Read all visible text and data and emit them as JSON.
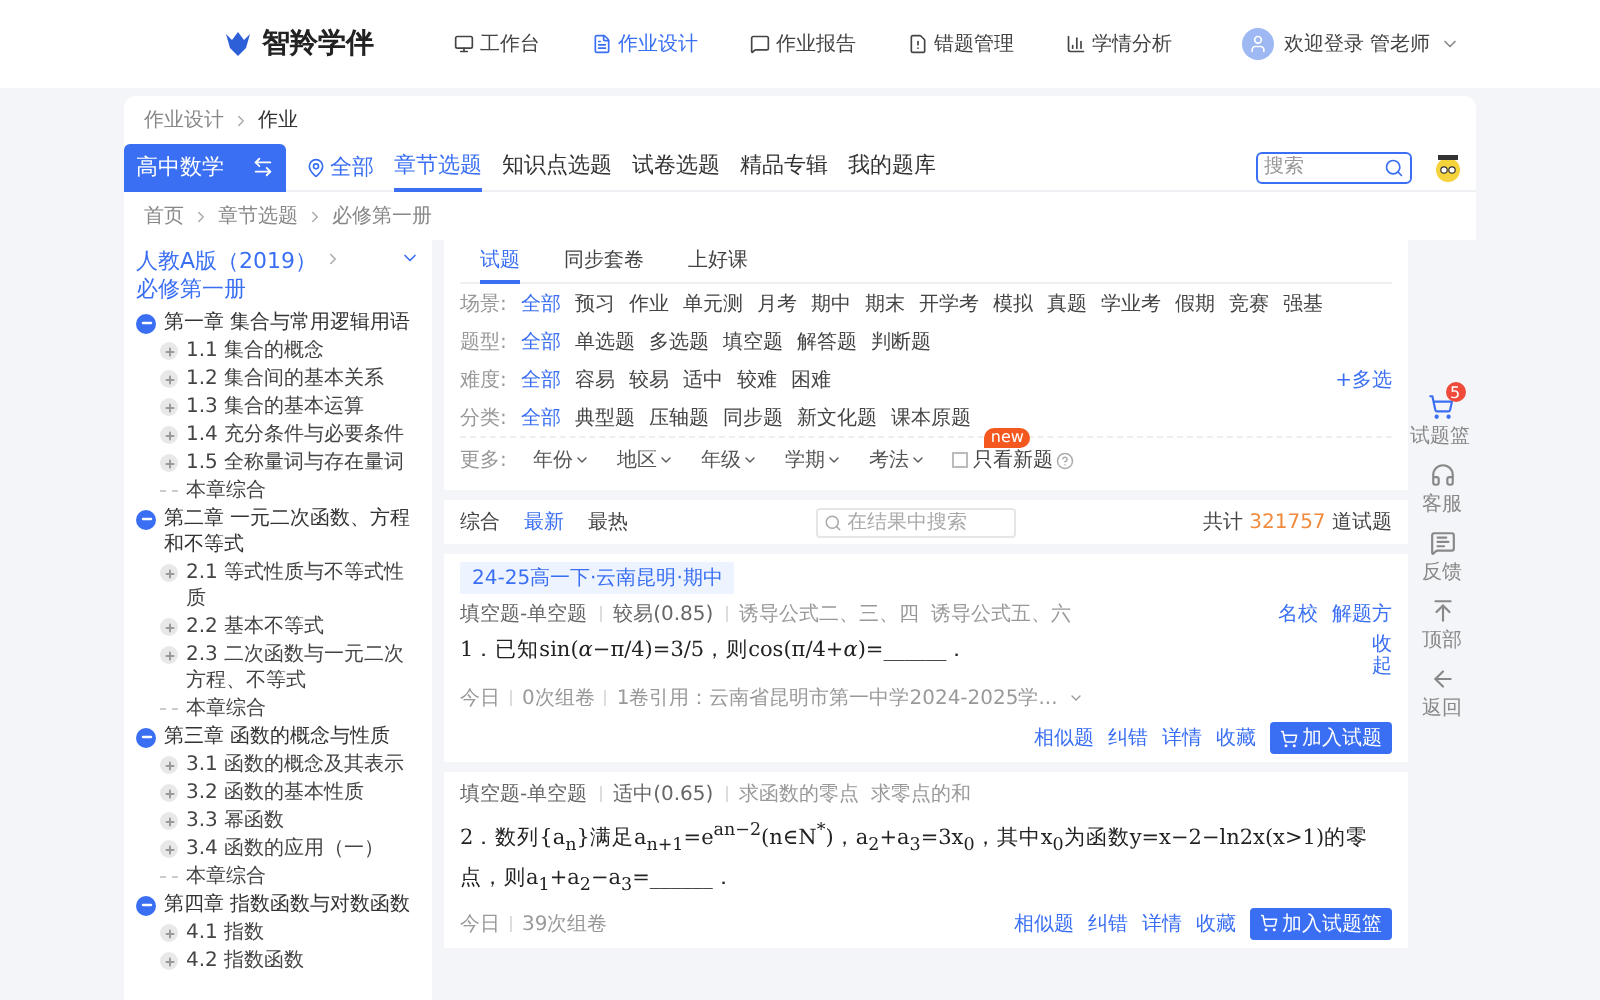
{
  "header": {
    "brand": "智羚学伴",
    "nav": [
      {
        "label": "工作台",
        "selected": false
      },
      {
        "label": "作业设计",
        "selected": true
      },
      {
        "label": "作业报告",
        "selected": false
      },
      {
        "label": "错题管理",
        "selected": false
      },
      {
        "label": "学情分析",
        "selected": false
      }
    ],
    "user": "欢迎登录 管老师"
  },
  "breadcrumb": [
    "作业设计",
    "作业"
  ],
  "subject": "高中数学",
  "location": "全部",
  "tabs": [
    {
      "label": "章节选题",
      "selected": true
    },
    {
      "label": "知识点选题",
      "selected": false
    },
    {
      "label": "试卷选题",
      "selected": false
    },
    {
      "label": "精品专辑",
      "selected": false
    },
    {
      "label": "我的题库",
      "selected": false
    }
  ],
  "search": {
    "placeholder": "搜索"
  },
  "sub_breadcrumb": [
    "首页",
    "章节选题",
    "必修第一册"
  ],
  "sidebar": {
    "edition": "人教A版（2019）",
    "volume": "必修第一册",
    "chapters": [
      {
        "label": "第一章 集合与常用逻辑用语",
        "expanded": true,
        "children": [
          {
            "label": "1.1 集合的概念",
            "kind": "node"
          },
          {
            "label": "1.2 集合间的基本关系",
            "kind": "node"
          },
          {
            "label": "1.3 集合的基本运算",
            "kind": "node"
          },
          {
            "label": "1.4 充分条件与必要条件",
            "kind": "node"
          },
          {
            "label": "1.5 全称量词与存在量词",
            "kind": "node"
          },
          {
            "label": "本章综合",
            "kind": "leaf"
          }
        ]
      },
      {
        "label": "第二章 一元二次函数、方程和不等式",
        "expanded": true,
        "children": [
          {
            "label": "2.1 等式性质与不等式性质",
            "kind": "node"
          },
          {
            "label": "2.2 基本不等式",
            "kind": "node"
          },
          {
            "label": "2.3 二次函数与一元二次方程、不等式",
            "kind": "node"
          },
          {
            "label": "本章综合",
            "kind": "leaf"
          }
        ]
      },
      {
        "label": "第三章 函数的概念与性质",
        "expanded": true,
        "children": [
          {
            "label": "3.1 函数的概念及其表示",
            "kind": "node"
          },
          {
            "label": "3.2 函数的基本性质",
            "kind": "node"
          },
          {
            "label": "3.3 幂函数",
            "kind": "node"
          },
          {
            "label": "3.4 函数的应用（一）",
            "kind": "node"
          },
          {
            "label": "本章综合",
            "kind": "leaf"
          }
        ]
      },
      {
        "label": "第四章 指数函数与对数函数",
        "expanded": true,
        "children": [
          {
            "label": "4.1 指数",
            "kind": "node"
          },
          {
            "label": "4.2 指数函数",
            "kind": "node"
          }
        ]
      }
    ]
  },
  "content_tabs": [
    {
      "label": "试题",
      "selected": true
    },
    {
      "label": "同步套卷",
      "selected": false
    },
    {
      "label": "上好课",
      "selected": false
    }
  ],
  "filters": [
    {
      "label": "场景:",
      "options": [
        {
          "label": "全部",
          "selected": true
        },
        {
          "label": "预习",
          "selected": false
        },
        {
          "label": "作业",
          "selected": false
        },
        {
          "label": "单元测",
          "selected": false
        },
        {
          "label": "月考",
          "selected": false
        },
        {
          "label": "期中",
          "selected": false
        },
        {
          "label": "期末",
          "selected": false
        },
        {
          "label": "开学考",
          "selected": false
        },
        {
          "label": "模拟",
          "selected": false
        },
        {
          "label": "真题",
          "selected": false
        },
        {
          "label": "学业考",
          "selected": false
        },
        {
          "label": "假期",
          "selected": false
        },
        {
          "label": "竞赛",
          "selected": false
        },
        {
          "label": "强基",
          "selected": false
        }
      ]
    },
    {
      "label": "题型:",
      "options": [
        {
          "label": "全部",
          "selected": true
        },
        {
          "label": "单选题",
          "selected": false
        },
        {
          "label": "多选题",
          "selected": false
        },
        {
          "label": "填空题",
          "selected": false
        },
        {
          "label": "解答题",
          "selected": false
        },
        {
          "label": "判断题",
          "selected": false
        }
      ]
    },
    {
      "label": "难度:",
      "extra": "+多选",
      "options": [
        {
          "label": "全部",
          "selected": true
        },
        {
          "label": "容易",
          "selected": false
        },
        {
          "label": "较易",
          "selected": false
        },
        {
          "label": "适中",
          "selected": false
        },
        {
          "label": "较难",
          "selected": false
        },
        {
          "label": "困难",
          "selected": false
        }
      ]
    },
    {
      "label": "分类:",
      "options": [
        {
          "label": "全部",
          "selected": true
        },
        {
          "label": "典型题",
          "selected": false
        },
        {
          "label": "压轴题",
          "selected": false
        },
        {
          "label": "同步题",
          "selected": false
        },
        {
          "label": "新文化题",
          "selected": false
        },
        {
          "label": "课本原题",
          "selected": false
        }
      ]
    }
  ],
  "more": {
    "label": "更多:",
    "dropdowns": [
      "年份",
      "地区",
      "年级",
      "学期",
      "考法"
    ],
    "new_only": {
      "label": "只看新题",
      "checked": false,
      "badge": "new"
    }
  },
  "sort": {
    "options": [
      {
        "label": "综合",
        "selected": false
      },
      {
        "label": "最新",
        "selected": true
      },
      {
        "label": "最热",
        "selected": false
      }
    ],
    "placeholder": "在结果中搜索",
    "total_prefix": "共计",
    "total": "321757",
    "total_suffix": "道试题"
  },
  "questions": [
    {
      "source": "24-25高一下·云南昆明·期中",
      "type": "填空题-单空题",
      "difficulty": "较易(0.85)",
      "knowledge": [
        "诱导公式二、三、四",
        "诱导公式五、六"
      ],
      "links": [
        "名校",
        "解题方"
      ],
      "stem": "1．已知sin(*α*−π/4)=3/5，则cos(π/4+*α*)=______．",
      "collapse": "收起",
      "date": "今日",
      "uses": "0次组卷",
      "cited": "1卷引用：云南省昆明市第一中学2024-2025学...",
      "actions": [
        "相似题",
        "纠错",
        "详情",
        "收藏"
      ],
      "add": "加入试题"
    },
    {
      "type": "填空题-单空题",
      "difficulty": "适中(0.65)",
      "knowledge": [
        "求函数的零点",
        "求零点的和"
      ],
      "stem": "2．数列{a$_{n}$}满足a$_{n+1}$=e$^{an−2}$(n∈N$^{*}$)，a$_{2}$+a$_{3}$=3x$_{0}$，其中x$_{0}$为函数y=x−2−ln2x(x>1)的零点，则a$_{1}$+a$_{2}$−a$_{3}$=______．",
      "date": "今日",
      "uses": "39次组卷",
      "actions": [
        "相似题",
        "纠错",
        "详情",
        "收藏"
      ],
      "add": "加入试题篮"
    }
  ],
  "side_tools": {
    "cart_count": "5",
    "cart_label": "试题篮",
    "items": [
      "客服",
      "反馈",
      "顶部",
      "返回"
    ]
  }
}
